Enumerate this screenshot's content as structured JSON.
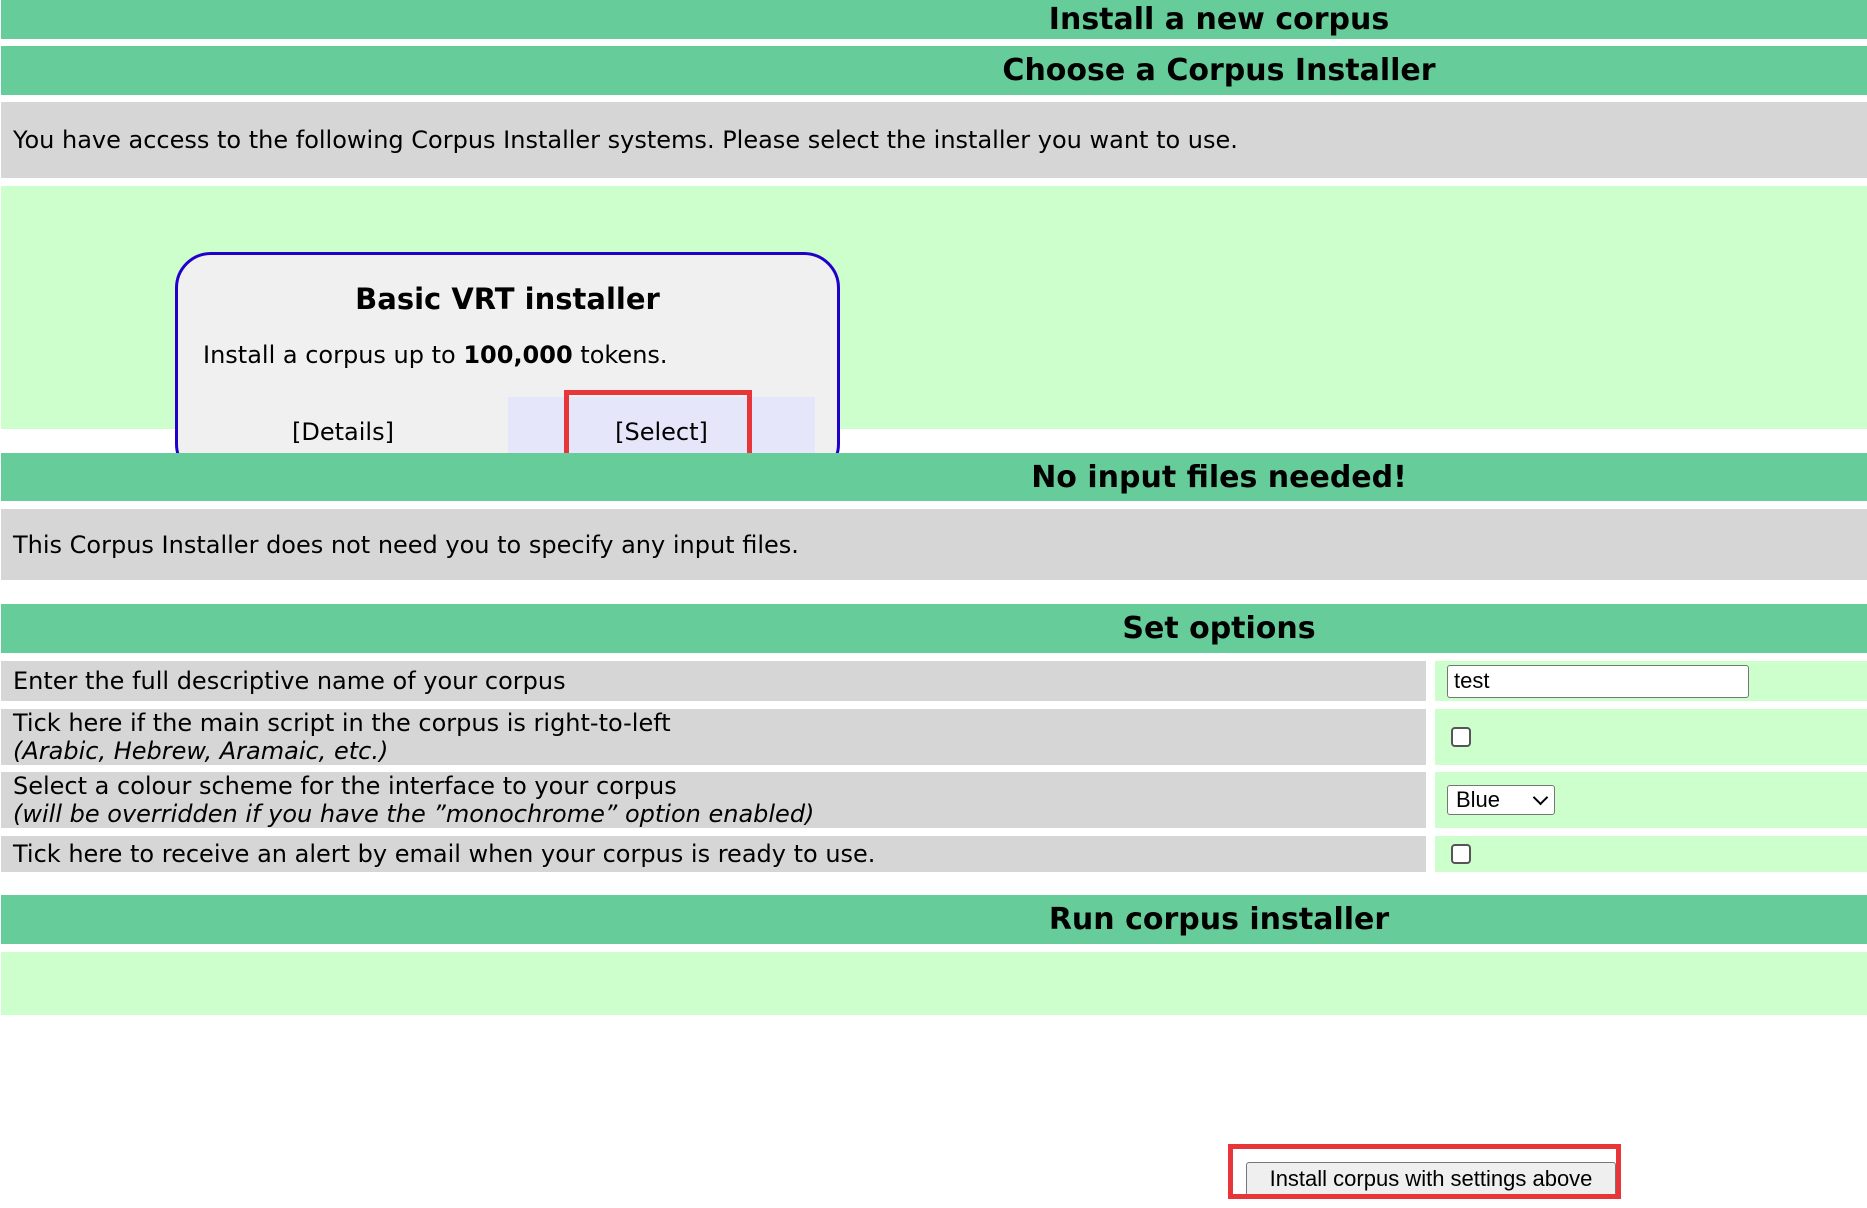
{
  "header": {
    "title": "Install a new corpus"
  },
  "installer_section": {
    "heading": "Choose a Corpus Installer",
    "intro": "You have access to the following Corpus Installer systems. Please select the installer you want to use.",
    "card": {
      "title": "Basic VRT installer",
      "desc_prefix": "Install a corpus up to ",
      "desc_bold": "100,000",
      "desc_suffix": " tokens.",
      "details_label": "[Details]",
      "select_label": "[Select]"
    }
  },
  "input_files": {
    "heading": "No input files needed!",
    "message": "This Corpus Installer does not need you to specify any input files."
  },
  "options": {
    "heading": "Set options",
    "name_label": "Enter the full descriptive name of your corpus",
    "name_value": "test",
    "rtl_label": "Tick here if the main script in the corpus is right-to-left",
    "rtl_sub": "(Arabic, Hebrew, Aramaic, etc.)",
    "colour_label": "Select a colour scheme for the interface to your corpus",
    "colour_sub": "(will be overridden if you have the ”monochrome” option enabled)",
    "colour_value": "Blue",
    "email_label": "Tick here to receive an alert by email when your corpus is ready to use."
  },
  "run": {
    "heading": "Run corpus installer",
    "button_label": "Install corpus with settings above"
  },
  "colors": {
    "heading_green": "#66cc99",
    "light_green": "#ccffcc",
    "grey": "#d6d6d6",
    "card_border": "#2200cc",
    "highlight_red": "#e8353a"
  }
}
